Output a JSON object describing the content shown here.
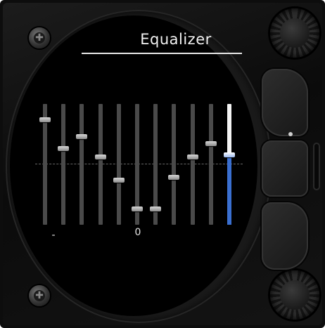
{
  "screen": {
    "title": "Equalizer"
  },
  "equalizer": {
    "bands": [
      {
        "level": 0.87,
        "selected": false
      },
      {
        "level": 0.63,
        "selected": false
      },
      {
        "level": 0.73,
        "selected": false
      },
      {
        "level": 0.56,
        "selected": false
      },
      {
        "level": 0.37,
        "selected": false
      },
      {
        "level": 0.13,
        "selected": false
      },
      {
        "level": 0.13,
        "selected": false
      },
      {
        "level": 0.39,
        "selected": false
      },
      {
        "level": 0.56,
        "selected": false
      },
      {
        "level": 0.67,
        "selected": false
      },
      {
        "level": 0.58,
        "selected": true
      }
    ],
    "left_label": "-",
    "center_label": "0"
  },
  "colors": {
    "accent": "#3a6fd0",
    "track": "#4a4a4a",
    "active_track": "#f4f4f4",
    "screen": "#000000"
  }
}
